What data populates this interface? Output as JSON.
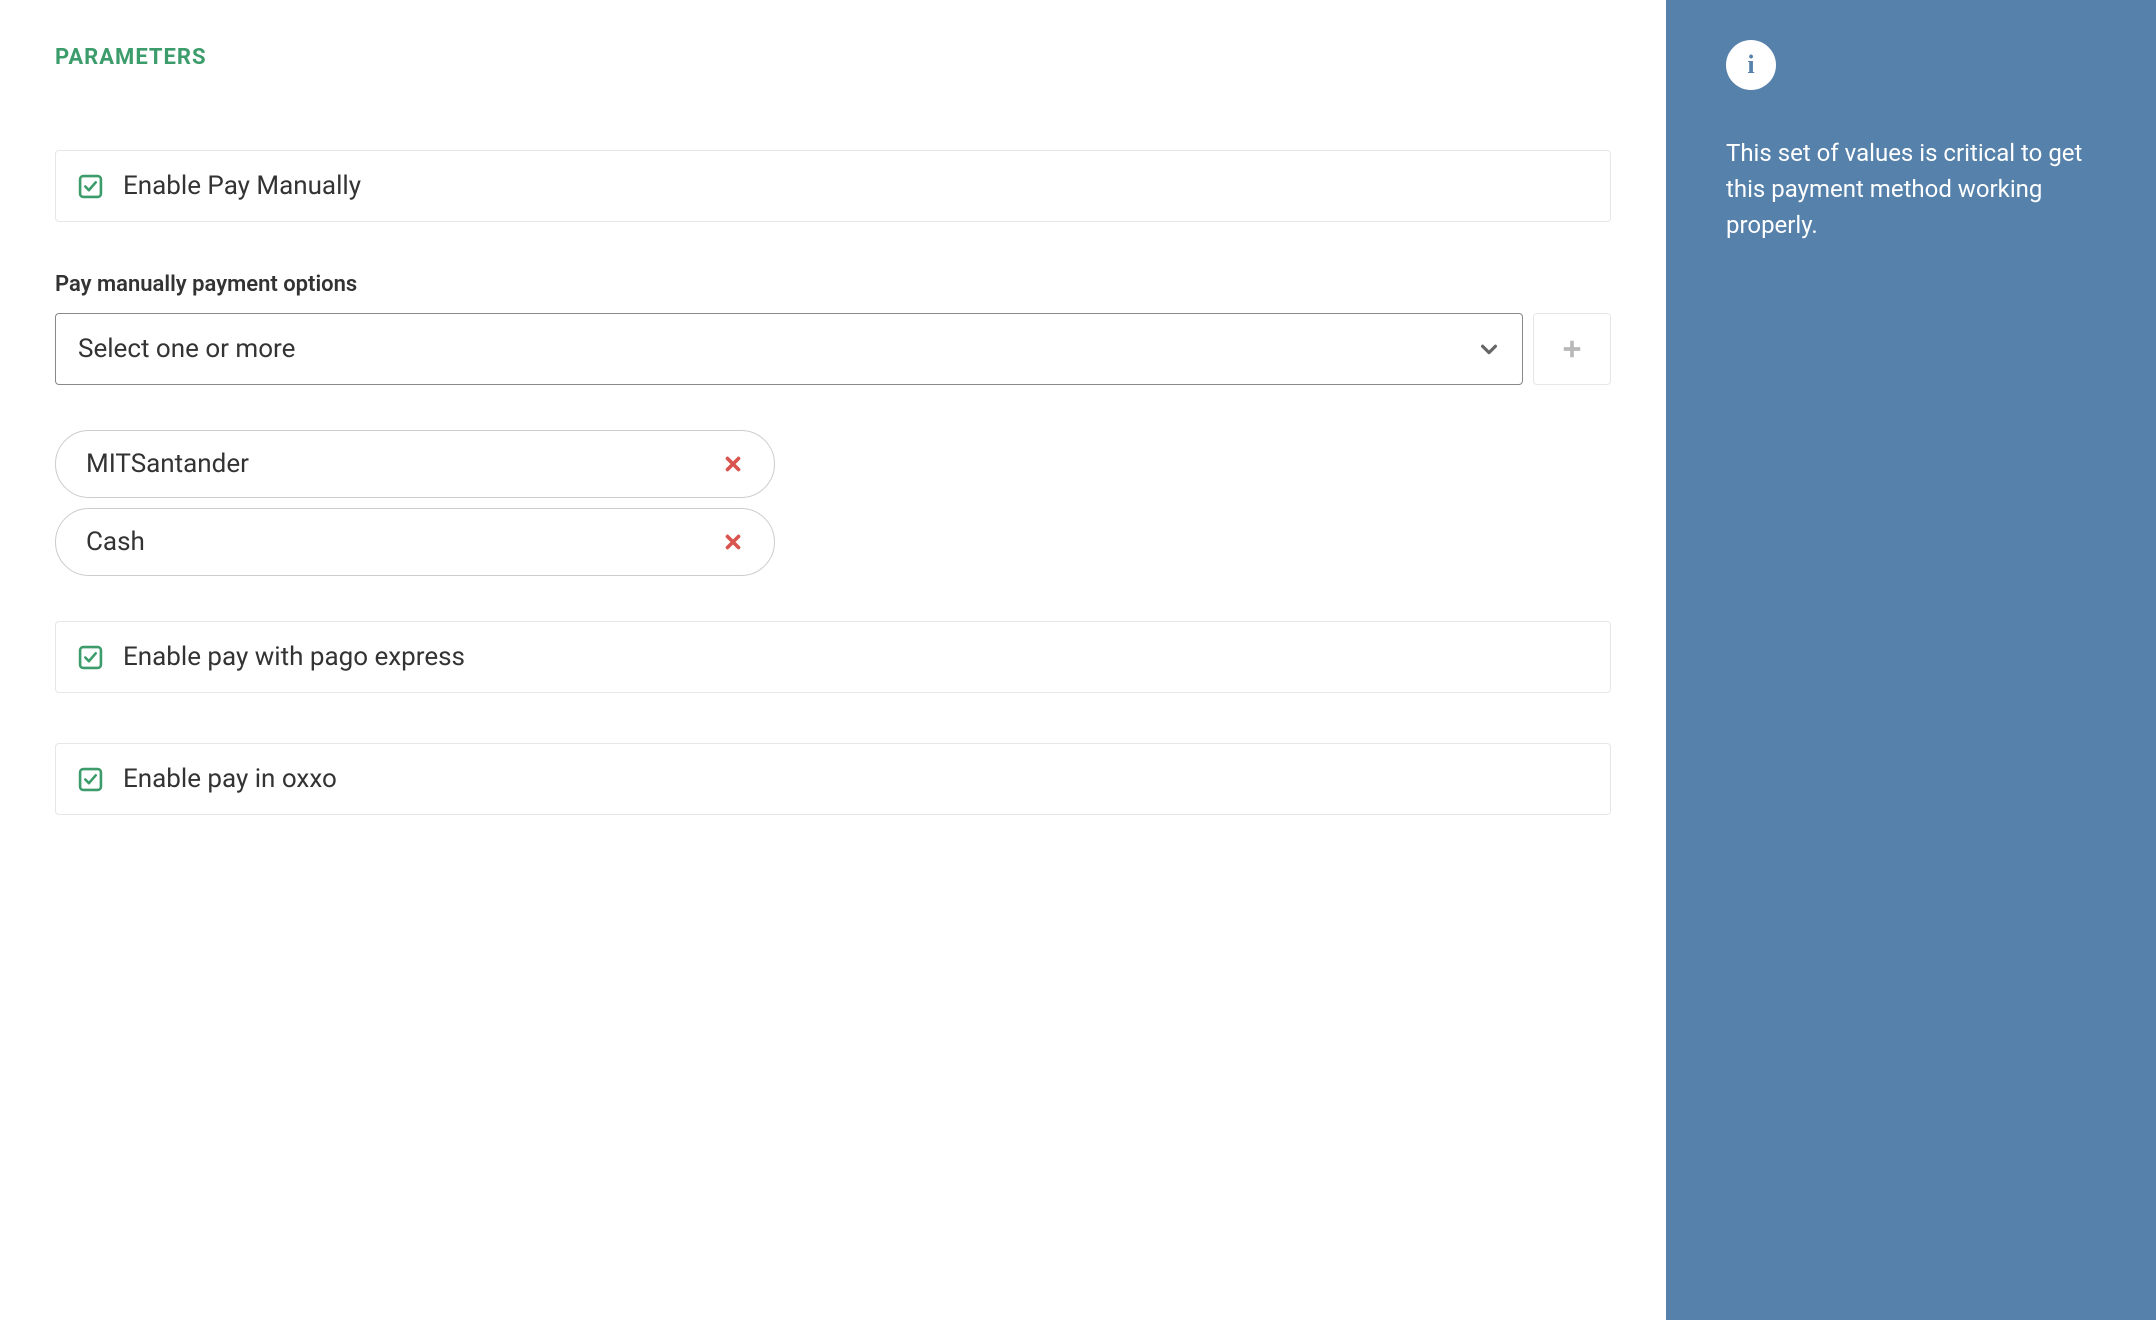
{
  "section_title": "PARAMETERS",
  "checkboxes": {
    "enable_pay_manually": {
      "label": "Enable Pay Manually",
      "checked": true
    },
    "enable_pago_express": {
      "label": "Enable pay with pago express",
      "checked": true
    },
    "enable_oxxo": {
      "label": "Enable pay in oxxo",
      "checked": true
    }
  },
  "payment_options": {
    "label": "Pay manually payment options",
    "placeholder": "Select one or more",
    "selected": [
      "MITSantander",
      "Cash"
    ]
  },
  "info_panel": {
    "icon_letter": "i",
    "text": "This set of values is critical to get this payment method working properly."
  },
  "colors": {
    "accent_green": "#3d9c6b",
    "sidebar_blue": "#5581ab",
    "close_red": "#d9534f",
    "checkbox_green": "#3d9c6b",
    "plus_gray": "#b8b8b8"
  }
}
